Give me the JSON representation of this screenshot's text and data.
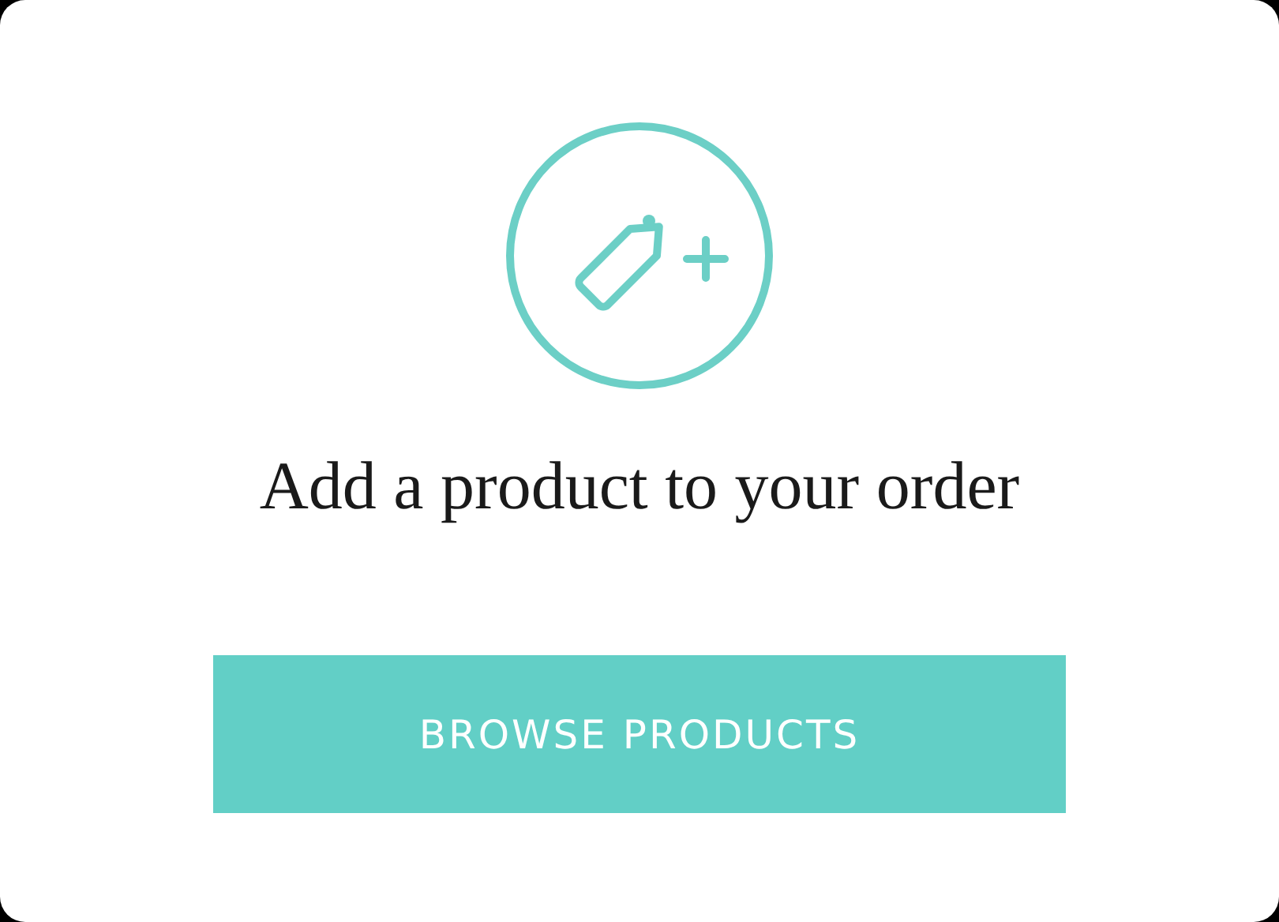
{
  "heading": "Add a product to your order",
  "button": {
    "label": "BROWSE PRODUCTS"
  }
}
